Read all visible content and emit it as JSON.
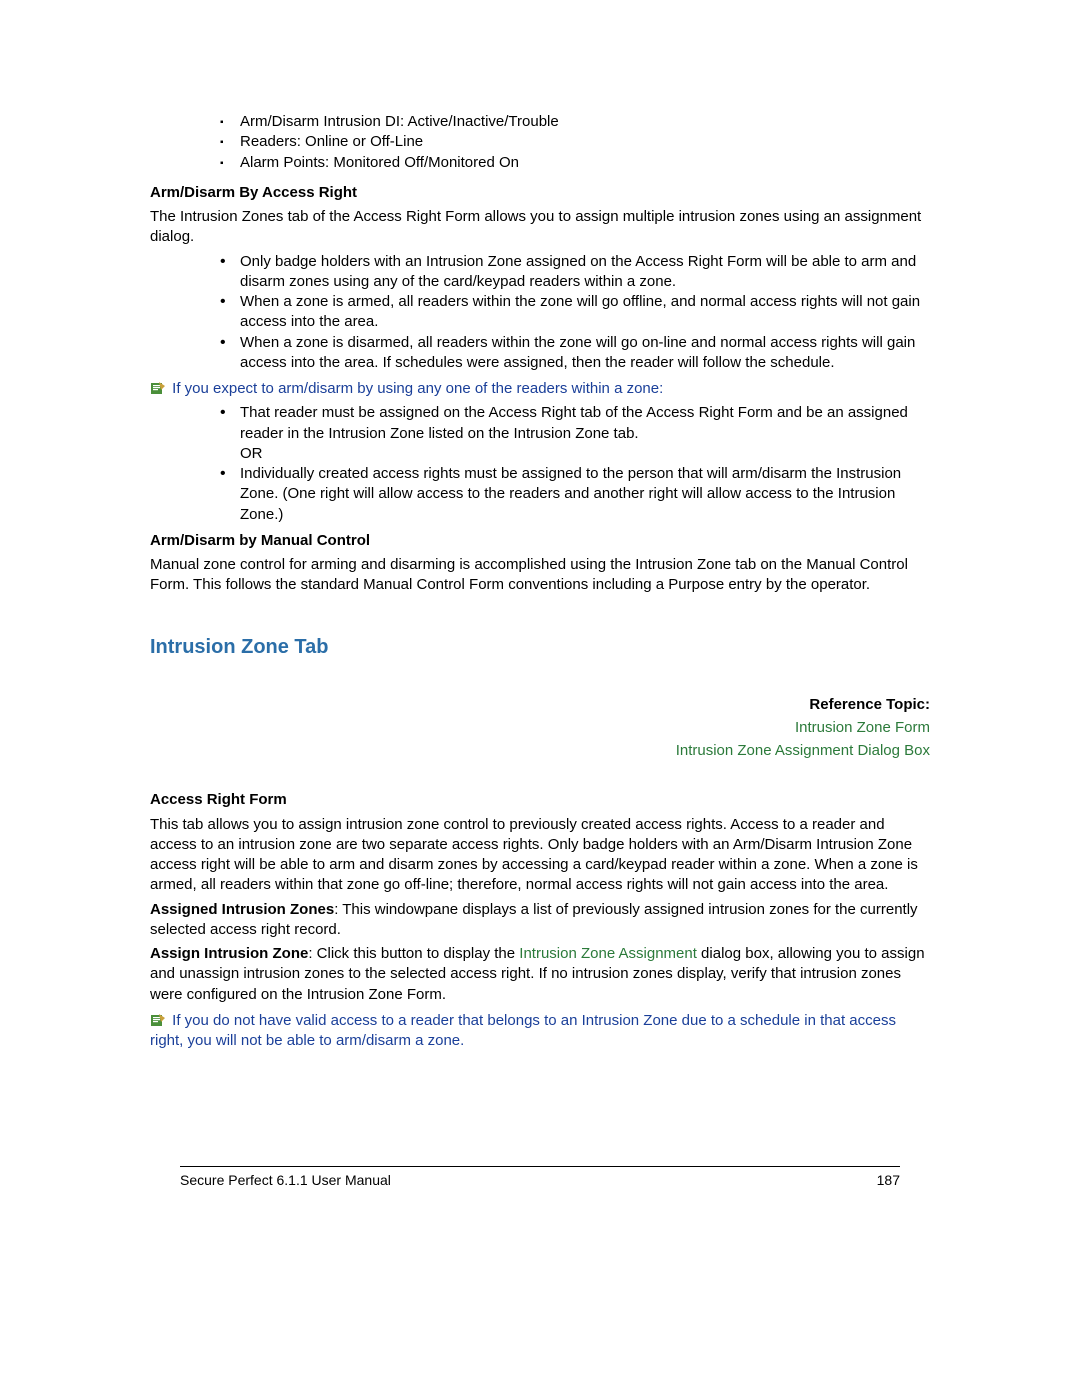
{
  "top_list": {
    "items": [
      "Arm/Disarm Intrusion DI: Active/Inactive/Trouble",
      "Readers: Online or Off-Line",
      "Alarm Points: Monitored Off/Monitored On"
    ]
  },
  "sec1": {
    "heading": "Arm/Disarm By Access Right",
    "intro": "The Intrusion Zones tab of the Access Right Form allows you to assign multiple intrusion zones using an assignment dialog.",
    "bullets": [
      "Only badge holders with an Intrusion Zone assigned on the Access Right Form will be able to arm and disarm zones using any of the card/keypad readers within a zone.",
      "When a zone is armed, all readers within the zone will go offline, and normal access rights will not gain access into the area.",
      "When a zone is disarmed, all readers within the zone will go on-line and normal access rights will gain access into the area. If schedules were assigned, then the reader will follow the schedule."
    ],
    "note": "If you expect to arm/disarm by using any one of the readers within a zone:",
    "note_bullets": [
      "That reader must be assigned on the Access Right tab of the Access Right Form and be an assigned reader in the Intrusion Zone listed on the Intrusion Zone tab.\nOR",
      "Individually created access rights must be assigned to the person that will arm/disarm the Instrusion Zone. (One right will allow access to the readers and another right will allow access to the Intrusion Zone.)"
    ]
  },
  "sec2": {
    "heading": "Arm/Disarm by Manual Control",
    "body": "Manual zone control for arming and disarming is accomplished using the Intrusion Zone tab on the Manual Control Form. This follows the standard Manual Control Form conventions including a Purpose entry by the operator."
  },
  "section_title": "Intrusion Zone Tab",
  "ref": {
    "heading": "Reference Topic:",
    "link1": "Intrusion Zone Form",
    "link2": "Intrusion Zone Assignment Dialog Box"
  },
  "arf": {
    "heading": "Access Right Form",
    "p1": "This tab allows you to assign intrusion zone control to previously created access rights. Access to a reader and access to an intrusion zone are two separate access rights. Only badge holders with an Arm/Disarm Intrusion Zone access right will be able to arm and disarm zones by accessing a card/keypad reader within a zone. When a zone is armed, all readers within that zone go off-line; therefore, normal access rights will not gain access into the area.",
    "p2_label": "Assigned Intrusion Zones",
    "p2_rest": ": This windowpane displays a list of previously assigned intrusion zones for the currently selected access right record.",
    "p3_label": "Assign Intrusion Zone",
    "p3_mid_a": ": Click this button to display the ",
    "p3_link": "Intrusion Zone Assignment",
    "p3_mid_b": " dialog box, allowing you to assign and unassign intrusion zones to the selected access right. If no intrusion zones display, verify that intrusion zones were configured on the Intrusion Zone Form.",
    "note": "If you do not have valid access to a reader that belongs to an Intrusion Zone due to a schedule in that access right, you will not be able to arm/disarm a zone."
  },
  "footer": {
    "left": "Secure Perfect 6.1.1 User Manual",
    "page": "187"
  }
}
